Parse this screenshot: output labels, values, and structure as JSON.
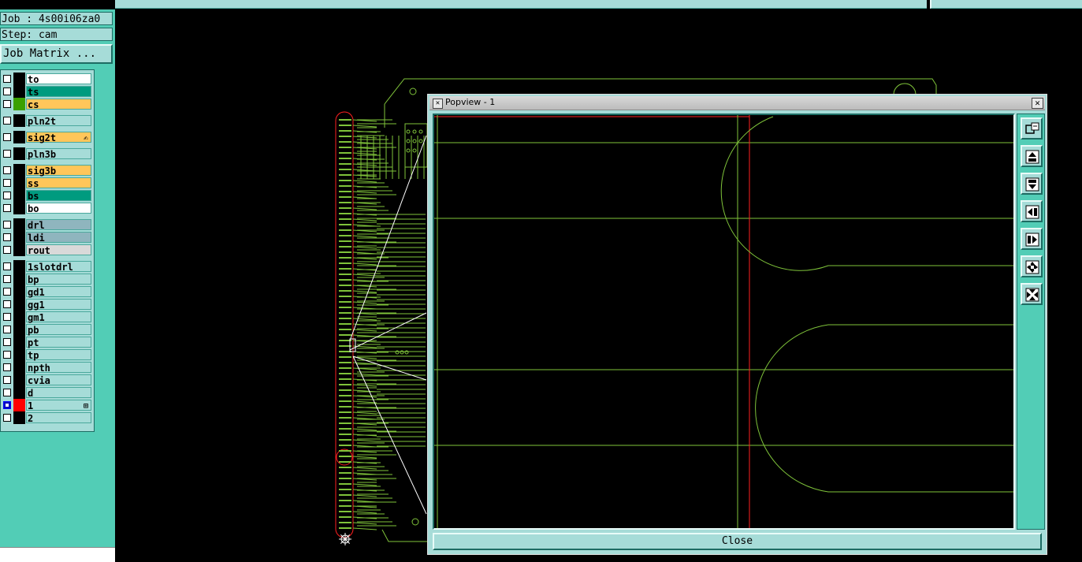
{
  "job": {
    "job_line": "Job : 4s00i06za0",
    "step_line": "Step: cam",
    "matrix_button": "Job Matrix ..."
  },
  "layers": [
    {
      "name": "to",
      "bg": "#ffffff",
      "color": "#000000"
    },
    {
      "name": "ts",
      "bg": "#009b7f",
      "color": "#000000"
    },
    {
      "name": "cs",
      "bg": "#ffc65a",
      "color": "#3aa000"
    },
    {
      "name": "pln2t",
      "bg": "#a6dcd8",
      "color": "#000000"
    },
    {
      "name": "sig2t",
      "bg": "#ffc65a",
      "color": "#000000",
      "mark": "✍"
    },
    {
      "name": "pln3b",
      "bg": "#a6dcd8",
      "color": "#000000"
    },
    {
      "name": "sig3b",
      "bg": "#ffc65a",
      "color": "#000000"
    },
    {
      "name": "ss",
      "bg": "#ffc65a",
      "color": "#000000"
    },
    {
      "name": "bs",
      "bg": "#009b7f",
      "color": "#000000"
    },
    {
      "name": "bo",
      "bg": "#ffffff",
      "color": "#000000"
    },
    {
      "name": "drl",
      "bg": "#8fb5be",
      "color": "#000000"
    },
    {
      "name": "ldi",
      "bg": "#8fb5be",
      "color": "#000000"
    },
    {
      "name": "rout",
      "bg": "#d9d9d9",
      "color": "#000000"
    },
    {
      "name": "1slotdrl",
      "bg": "#a6dcd8",
      "color": "#000000"
    },
    {
      "name": "bp",
      "bg": "#a6dcd8",
      "color": "#000000"
    },
    {
      "name": "gd1",
      "bg": "#a6dcd8",
      "color": "#000000"
    },
    {
      "name": "gg1",
      "bg": "#a6dcd8",
      "color": "#000000"
    },
    {
      "name": "gm1",
      "bg": "#a6dcd8",
      "color": "#000000"
    },
    {
      "name": "pb",
      "bg": "#a6dcd8",
      "color": "#000000"
    },
    {
      "name": "pt",
      "bg": "#a6dcd8",
      "color": "#000000"
    },
    {
      "name": "tp",
      "bg": "#a6dcd8",
      "color": "#000000"
    },
    {
      "name": "npth",
      "bg": "#a6dcd8",
      "color": "#000000"
    },
    {
      "name": "cvia",
      "bg": "#a6dcd8",
      "color": "#000000"
    },
    {
      "name": "d",
      "bg": "#a6dcd8",
      "color": "#000000"
    },
    {
      "name": "1",
      "bg": "#a6dcd8",
      "color": "#ff0000",
      "mark": "⊞",
      "active": true
    },
    {
      "name": "2",
      "bg": "#a6dcd8",
      "color": "#000000"
    }
  ],
  "popview": {
    "title": "Popview - 1",
    "close_label": "Close",
    "tools": [
      "zoom-window-icon",
      "pan-up-icon",
      "pan-down-icon",
      "pan-left-icon",
      "pan-right-icon",
      "zoom-in-icon",
      "zoom-out-icon"
    ]
  },
  "colors": {
    "panel": "#52cdb6",
    "panel_light": "#a6dcd8",
    "trace": "#7fc33a",
    "outline": "#ff2020"
  }
}
